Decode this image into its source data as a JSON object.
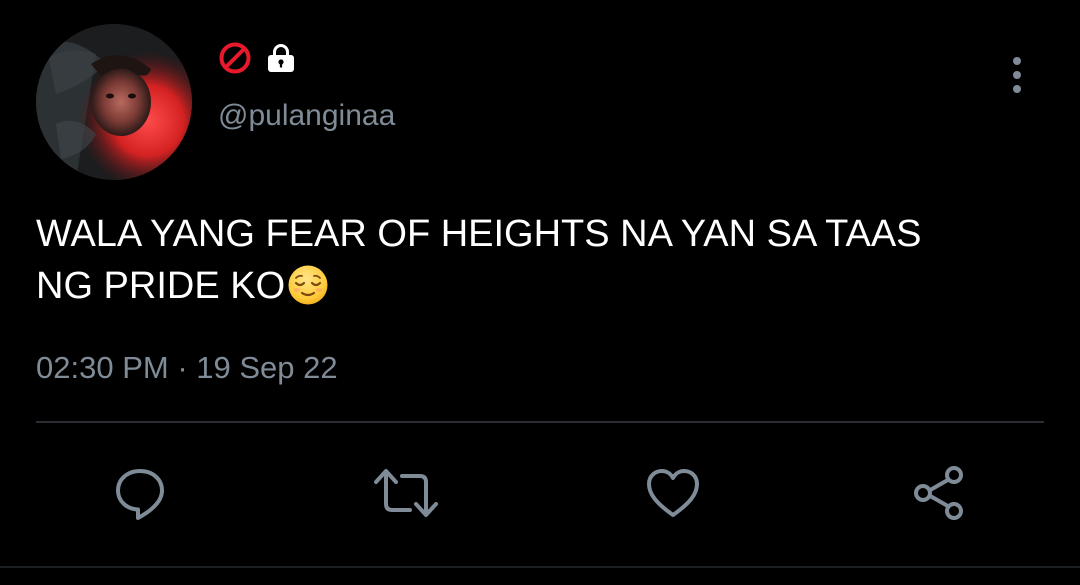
{
  "tweet": {
    "handle": "@pulanginaa",
    "text_line1": "WALA YANG FEAR OF HEIGHTS NA YAN SA TAAS",
    "text_line2": "NG PRIDE KO",
    "emoji": "relieved-face",
    "time": "02:30 PM",
    "separator": "·",
    "date": "19 Sep 22"
  },
  "header": {
    "name_icons": [
      "prohibited-icon",
      "lock-icon"
    ],
    "more_icon": "more-vertical-icon"
  },
  "actions": {
    "icons": [
      "reply-icon",
      "retweet-icon",
      "like-icon",
      "share-icon"
    ]
  },
  "colors": {
    "background": "#000000",
    "text": "#ffffff",
    "secondary": "#7f8b96",
    "prohibited": "#e8192c",
    "divider": "#2a2e33"
  }
}
